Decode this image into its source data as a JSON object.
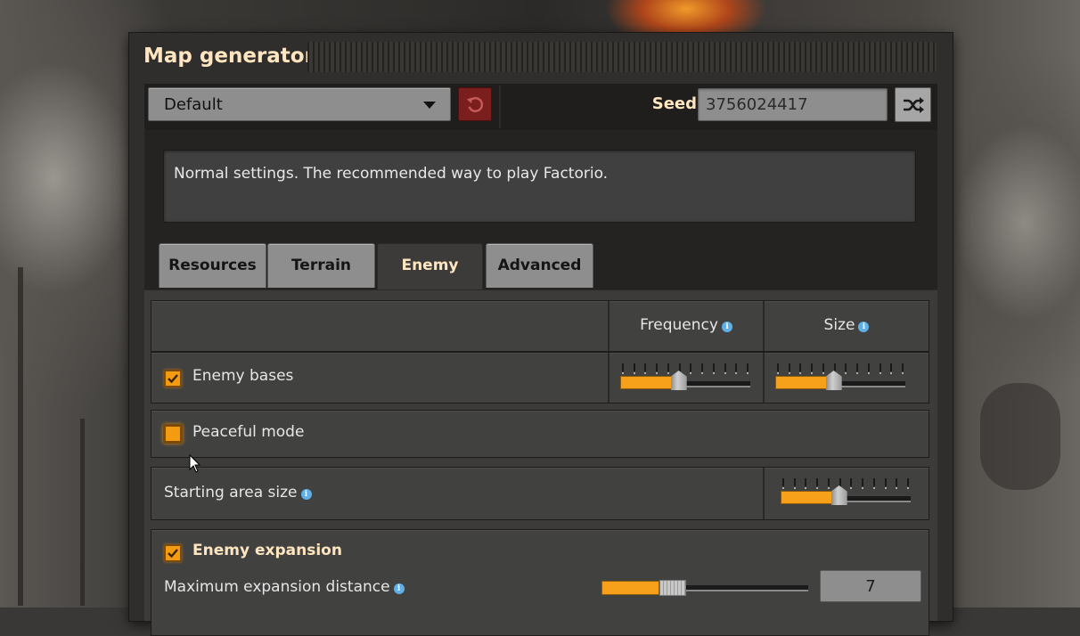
{
  "window": {
    "title": "Map generator"
  },
  "top_bar": {
    "preset": {
      "selected": "Default",
      "icon": "chevron-down-icon"
    },
    "reset_icon": "reset-icon",
    "seed": {
      "label": "Seed",
      "value": "3756024417"
    },
    "shuffle_icon": "shuffle-icon"
  },
  "description": "Normal settings. The recommended way to play Factorio.",
  "tabs": [
    {
      "label": "Resources",
      "active": false
    },
    {
      "label": "Terrain",
      "active": false
    },
    {
      "label": "Enemy",
      "active": true
    },
    {
      "label": "Advanced",
      "active": false
    }
  ],
  "enemy": {
    "columns": {
      "frequency": "Frequency",
      "size": "Size"
    },
    "enemy_bases": {
      "label": "Enemy bases",
      "checked": true,
      "frequency_position": 0.45,
      "size_position": 0.45
    },
    "peaceful_mode": {
      "label": "Peaceful mode",
      "checked": false
    },
    "starting_area": {
      "label": "Starting area size",
      "position": 0.45
    },
    "expansion": {
      "label": "Enemy expansion",
      "checked": true,
      "max_distance": {
        "label": "Maximum expansion distance",
        "value": "7",
        "position": 0.28
      }
    }
  },
  "colors": {
    "accent": "#f7a019",
    "title": "#ffe6c0",
    "info": "#5fb0e8",
    "reset": "#7a1e1e"
  }
}
